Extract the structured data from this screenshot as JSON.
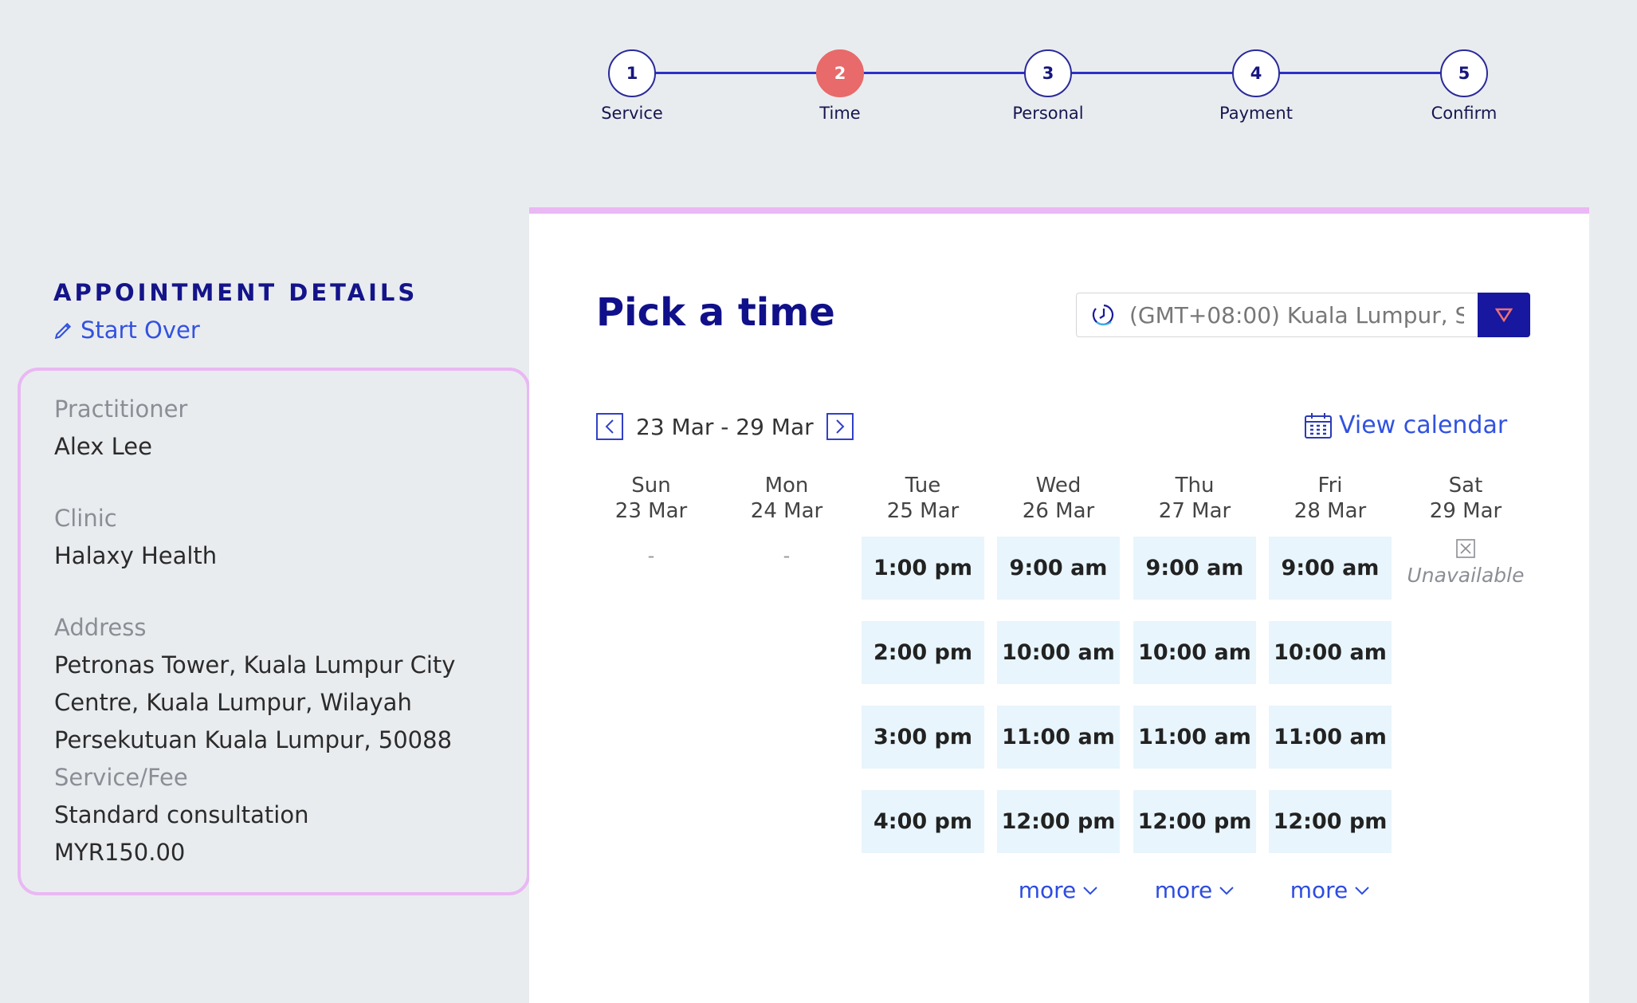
{
  "stepper": {
    "steps": [
      {
        "number": "1",
        "label": "Service"
      },
      {
        "number": "2",
        "label": "Time"
      },
      {
        "number": "3",
        "label": "Personal"
      },
      {
        "number": "4",
        "label": "Payment"
      },
      {
        "number": "5",
        "label": "Confirm"
      }
    ],
    "active_step": 2
  },
  "details": {
    "title": "APPOINTMENT DETAILS",
    "start_over": "Start Over",
    "practitioner_label": "Practitioner",
    "practitioner": "Alex Lee",
    "clinic_label": "Clinic",
    "clinic": "Halaxy Health",
    "address_label": "Address",
    "address_lines": [
      "Petronas Tower, Kuala Lumpur City",
      "Centre, Kuala Lumpur, Wilayah",
      "Persekutuan Kuala Lumpur, 50088"
    ],
    "service_label": "Service/Fee",
    "service": "Standard consultation",
    "fee": "MYR150.00"
  },
  "main": {
    "title": "Pick a time",
    "timezone": "(GMT+08:00) Kuala Lumpur, S",
    "week_range": "23 Mar - 29 Mar",
    "view_calendar": "View calendar",
    "more_label": "more",
    "unavailable_label": "Unavailable",
    "no_slots": "-",
    "days": [
      {
        "name": "Sun",
        "date": "23 Mar",
        "slots": []
      },
      {
        "name": "Mon",
        "date": "24 Mar",
        "slots": []
      },
      {
        "name": "Tue",
        "date": "25 Mar",
        "slots": [
          "1:00 pm",
          "2:00 pm",
          "3:00 pm",
          "4:00 pm"
        ]
      },
      {
        "name": "Wed",
        "date": "26 Mar",
        "slots": [
          "9:00 am",
          "10:00 am",
          "11:00 am",
          "12:00 pm"
        ]
      },
      {
        "name": "Thu",
        "date": "27 Mar",
        "slots": [
          "9:00 am",
          "10:00 am",
          "11:00 am",
          "12:00 pm"
        ]
      },
      {
        "name": "Fri",
        "date": "28 Mar",
        "slots": [
          "9:00 am",
          "10:00 am",
          "11:00 am",
          "12:00 pm"
        ]
      },
      {
        "name": "Sat",
        "date": "29 Mar",
        "slots": []
      }
    ]
  },
  "colors": {
    "accent": "#1717a0",
    "active_step": "#e86a6a",
    "link": "#3152e0",
    "slot_bg": "#e8f5fc",
    "highlight_border": "#e9b8f3"
  }
}
